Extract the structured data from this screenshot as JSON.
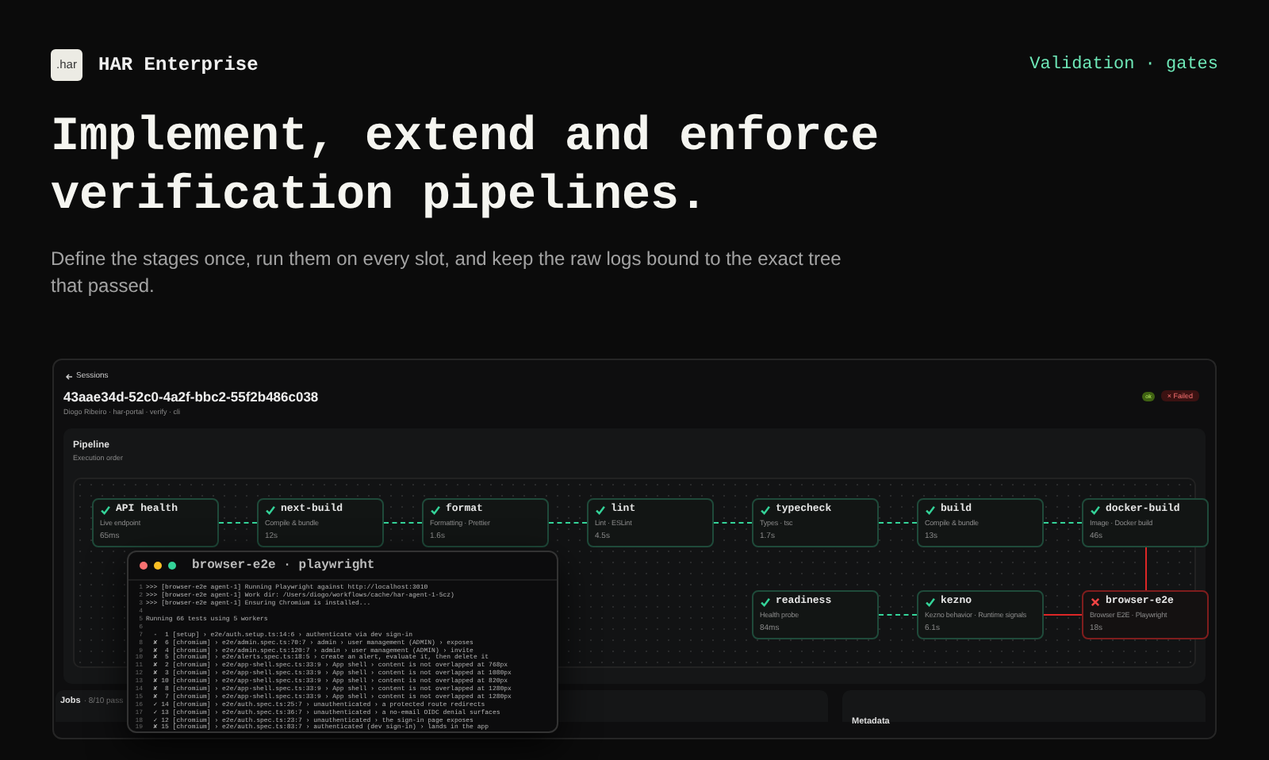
{
  "brand": {
    "logo": ".har",
    "name": "HAR Enterprise"
  },
  "nav_link": "Validation · gates",
  "hero": {
    "title": "Implement, extend and enforce verification pipelines.",
    "subtitle": "Define the stages once, run them on every slot, and keep the raw logs bound to the exact tree that passed."
  },
  "session": {
    "back": "Sessions",
    "id": "43aae34d-52c0-4a2f-bbc2-55f2b486c038",
    "meta": "Diogo Ribeiro · har-portal · verify · cli",
    "badges": [
      {
        "kind": "chip",
        "label": "ok"
      },
      {
        "kind": "failed",
        "label": "× Failed"
      }
    ]
  },
  "pipeline": {
    "title": "Pipeline",
    "subtitle": "Execution order",
    "rows": [
      [
        {
          "name": "API health",
          "detail": "Live endpoint",
          "time": "65ms",
          "failed": false,
          "joined_left": false,
          "joined_above": false
        },
        {
          "name": "next-build",
          "detail": "Compile & bundle",
          "time": "12s",
          "failed": false,
          "joined_left": true,
          "joined_above": false
        },
        {
          "name": "format",
          "detail": "Formatting · Prettier",
          "time": "1.6s",
          "failed": false,
          "joined_left": true,
          "joined_above": false
        },
        {
          "name": "lint",
          "detail": "Lint · ESLint",
          "time": "4.5s",
          "failed": false,
          "joined_left": true,
          "joined_above": false
        },
        {
          "name": "typecheck",
          "detail": "Types · tsc",
          "time": "1.7s",
          "failed": false,
          "joined_left": true,
          "joined_above": false
        },
        {
          "name": "build",
          "detail": "Compile & bundle",
          "time": "13s",
          "failed": false,
          "joined_left": true,
          "joined_above": false
        },
        {
          "name": "docker-build",
          "detail": "Image · Docker build",
          "time": "46s",
          "failed": false,
          "joined_left": true,
          "joined_above": false
        }
      ],
      [
        "",
        "",
        "",
        "",
        {
          "name": "readiness",
          "detail": "Health probe",
          "time": "84ms",
          "failed": false,
          "joined_left": false,
          "joined_above": false
        },
        {
          "name": "kezno",
          "detail": "Kezno behavior · Runtime signals",
          "time": "6.1s",
          "failed": false,
          "joined_left": true,
          "joined_above": false
        },
        {
          "name": "browser-e2e",
          "detail": "Browser E2E · Playwright",
          "time": "18s",
          "failed": true,
          "joined_left": true,
          "joined_above": true
        }
      ]
    ]
  },
  "jobs": {
    "title": "Jobs",
    "summary": "· 8/10 pass"
  },
  "metadata": {
    "title": "Metadata"
  },
  "terminal": {
    "title": "browser-e2e · playwright",
    "lines": [
      {
        "n": "1",
        "text": ">>> [browser-e2e agent-1] Running Playwright against http://localhost:3010"
      },
      {
        "n": "2",
        "text": ">>> [browser-e2e agent-1] Work dir: /Users/diogo/workflows/cache/har-agent-1-5cz)"
      },
      {
        "n": "3",
        "text": ">>> [browser-e2e agent-1] Ensuring Chromium is installed..."
      },
      {
        "n": "4"
      },
      {
        "n": "5",
        "text": "Running 66 tests using 5 workers"
      },
      {
        "n": "6"
      },
      {
        "n": "7",
        "text": "  -  1 [setup] › e2e/auth.setup.ts:14:6 › authenticate via dev sign-in"
      },
      {
        "n": "8",
        "text": "  ✘  6 [chromium] › e2e/admin.spec.ts:70:7 › admin › user management (ADMIN) › exposes"
      },
      {
        "n": "9",
        "text": "  ✘  4 [chromium] › e2e/admin.spec.ts:120:7 › admin › user management (ADMIN) › invite"
      },
      {
        "n": "10",
        "text": "  ✘  5 [chromium] › e2e/alerts.spec.ts:18:5 › create an alert, evaluate it, then delete it"
      },
      {
        "n": "11",
        "text": "  ✘  2 [chromium] › e2e/app-shell.spec.ts:33:9 › App shell › content is not overlapped at 768px"
      },
      {
        "n": "12",
        "text": "  ✘  3 [chromium] › e2e/app-shell.spec.ts:33:9 › App shell › content is not overlapped at 1080px"
      },
      {
        "n": "13",
        "text": "  ✘ 10 [chromium] › e2e/app-shell.spec.ts:33:9 › App shell › content is not overlapped at 820px"
      },
      {
        "n": "14",
        "text": "  ✘  8 [chromium] › e2e/app-shell.spec.ts:33:9 › App shell › content is not overlapped at 1280px"
      },
      {
        "n": "15",
        "text": "  ✘  7 [chromium] › e2e/app-shell.spec.ts:33:9 › App shell › content is not overlapped at 1280px"
      },
      {
        "n": "16",
        "text": "  ✓ 14 [chromium] › e2e/auth.spec.ts:25:7 › unauthenticated › a protected route redirects"
      },
      {
        "n": "17",
        "text": "  ✓ 13 [chromium] › e2e/auth.spec.ts:36:7 › unauthenticated › a no-email OIDC denial surfaces"
      },
      {
        "n": "18",
        "text": "  ✓ 12 [chromium] › e2e/auth.spec.ts:23:7 › unauthenticated › the sign-in page exposes"
      },
      {
        "n": "19",
        "text": "  ✘ 15 [chromium] › e2e/auth.spec.ts:83:7 › authenticated (dev sign-in) › lands in the app"
      }
    ]
  }
}
